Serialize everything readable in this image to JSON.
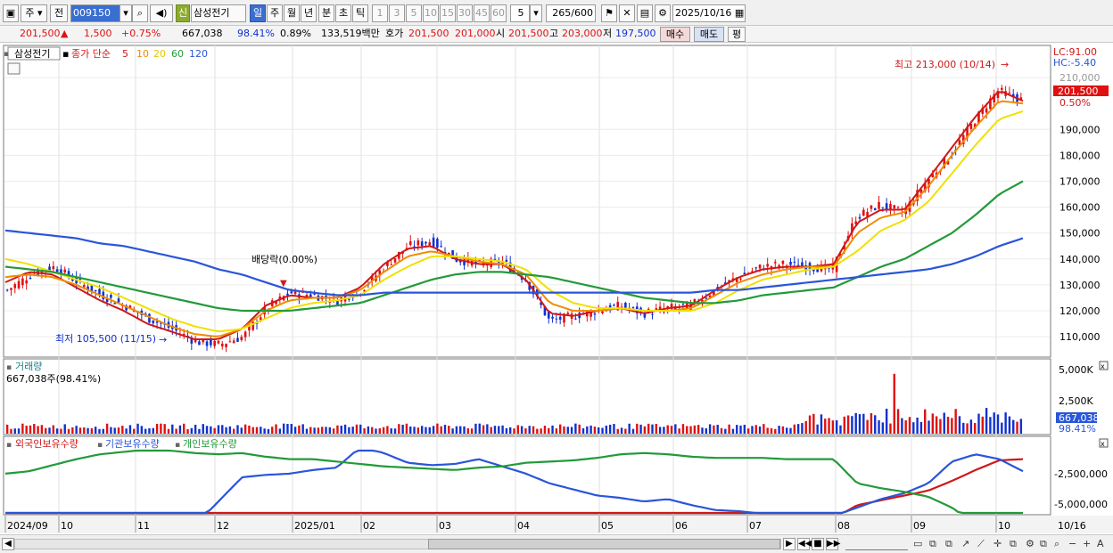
{
  "toolbar": {
    "market": "주",
    "period_type": "전",
    "code": "009150",
    "new_badge": "신",
    "stock_name": "삼성전기",
    "intervals": [
      "일",
      "주",
      "월",
      "년",
      "분",
      "초",
      "틱"
    ],
    "selected_interval": "일",
    "minute_options": [
      "1",
      "3",
      "5",
      "10",
      "15",
      "30",
      "45",
      "60"
    ],
    "count_value": "5",
    "bars_shown": "265",
    "bars_total": "/600",
    "date": "2025/10/16"
  },
  "infobar": {
    "price": "201,500",
    "change_arrow": "▲",
    "change": "1,500",
    "change_pct": "+0.75%",
    "volume": "667,038",
    "volume_ratio": "98.41%",
    "turnover": "0.89%",
    "amount": "133,519백만",
    "ask_label": "호가",
    "ask": "201,500",
    "bid": "201,000",
    "open_label": "시",
    "open": "201,500",
    "high_label": "고",
    "high": "203,000",
    "low_label": "저",
    "low": "197,500",
    "buy_label": "매수",
    "sell_label": "매도",
    "eval_label": "평"
  },
  "price_pane": {
    "name_tag": "삼성전기",
    "ma_label": "종가 단순",
    "ma_periods": [
      "5",
      "10",
      "20",
      "60",
      "120"
    ],
    "ma_colors": [
      "#d01818",
      "#f08c00",
      "#f0e000",
      "#229a3a",
      "#2a55d8"
    ],
    "high_annotation": "최고 213,000 (10/14)",
    "low_annotation": "최저 105,500 (11/15)",
    "dividend_annotation": "배당락(0.00%)",
    "lc": "LC:91.00",
    "hc": "HC:-5.40",
    "current_price_tag": "201,500",
    "current_pct_tag": "0.50%",
    "y_labels": [
      "210,000",
      "190,000",
      "180,000",
      "170,000",
      "160,000",
      "150,000",
      "140,000",
      "130,000",
      "120,000",
      "110,000"
    ]
  },
  "volume_pane": {
    "title": "거래량",
    "value_label": "667,038주(98.41%)",
    "y_labels": [
      "5,000K",
      "2,500K"
    ],
    "current_tag": "667,038",
    "current_pct": "98.41%"
  },
  "holdings_pane": {
    "legend": [
      "외국인보유수량",
      "기관보유수량",
      "개인보유수량"
    ],
    "legend_colors": [
      "#d01818",
      "#2a55d8",
      "#229a3a"
    ],
    "y_labels": [
      "-2,500,000",
      "-5,000,000"
    ]
  },
  "x_axis": {
    "labels": [
      "2024/09",
      "10",
      "11",
      "12",
      "2025/01",
      "02",
      "03",
      "04",
      "05",
      "06",
      "07",
      "08",
      "09",
      "10"
    ],
    "right_label": "10/16"
  },
  "chart_data": {
    "type": "line",
    "title": "삼성전기",
    "price_range": [
      100000,
      220000
    ],
    "daily_close_samples": [
      128000,
      134000,
      137000,
      131000,
      126000,
      122000,
      117000,
      113000,
      108000,
      107000,
      110000,
      121000,
      127000,
      126000,
      124000,
      128000,
      137000,
      145000,
      147000,
      140000,
      138000,
      139000,
      132000,
      116000,
      118000,
      120000,
      122000,
      119000,
      121000,
      122000,
      128000,
      133000,
      137000,
      138000,
      137000,
      136000,
      156000,
      161000,
      158000,
      170000,
      180000,
      193000,
      205000,
      201500
    ],
    "series": [
      {
        "name": "5",
        "values": [
          131000,
          135000,
          134000,
          129000,
          124000,
          120000,
          115000,
          112000,
          109000,
          109000,
          113000,
          122000,
          126000,
          125000,
          125000,
          129000,
          138000,
          144000,
          145000,
          140000,
          138000,
          138000,
          132000,
          119000,
          118000,
          120000,
          121000,
          119000,
          121000,
          122000,
          128000,
          133000,
          136000,
          137000,
          137000,
          138000,
          154000,
          159000,
          159000,
          171000,
          183000,
          195000,
          205000,
          201000
        ]
      },
      {
        "name": "10",
        "values": [
          133000,
          134000,
          133000,
          130000,
          126000,
          122000,
          118000,
          114000,
          111000,
          110000,
          113000,
          120000,
          124000,
          125000,
          125000,
          128000,
          135000,
          141000,
          143000,
          141000,
          139000,
          138000,
          134000,
          123000,
          120000,
          120000,
          121000,
          120000,
          120000,
          121000,
          126000,
          131000,
          134000,
          136000,
          137000,
          137000,
          150000,
          156000,
          158000,
          168000,
          180000,
          191000,
          201000,
          200000
        ]
      },
      {
        "name": "20",
        "values": [
          140000,
          138000,
          135000,
          132000,
          129000,
          125000,
          121000,
          117000,
          114000,
          112000,
          113000,
          117000,
          121000,
          123000,
          124000,
          126000,
          132000,
          137000,
          141000,
          141000,
          140000,
          139000,
          136000,
          128000,
          123000,
          121000,
          121000,
          120000,
          120000,
          120000,
          123000,
          128000,
          132000,
          134000,
          136000,
          137000,
          143000,
          151000,
          155000,
          162000,
          173000,
          184000,
          194000,
          197000
        ]
      },
      {
        "name": "60",
        "values": [
          137000,
          136000,
          135000,
          133000,
          131000,
          129000,
          127000,
          125000,
          123000,
          121000,
          120000,
          120000,
          120000,
          121000,
          122000,
          123000,
          126000,
          129000,
          132000,
          134000,
          135000,
          135000,
          134000,
          133000,
          131000,
          129000,
          127000,
          125000,
          124000,
          123000,
          123000,
          124000,
          126000,
          127000,
          128000,
          129000,
          133000,
          137000,
          140000,
          145000,
          150000,
          157000,
          165000,
          170000
        ]
      },
      {
        "name": "120",
        "values": [
          151000,
          150000,
          149000,
          148000,
          146000,
          145000,
          143000,
          141000,
          139000,
          136000,
          134000,
          131000,
          128000,
          127000,
          126000,
          126000,
          127000,
          127000,
          127000,
          127000,
          127000,
          127000,
          127000,
          127000,
          127000,
          127000,
          127000,
          127000,
          127000,
          127000,
          128000,
          128000,
          129000,
          130000,
          131000,
          132000,
          133000,
          134000,
          135000,
          136000,
          138000,
          141000,
          145000,
          148000
        ]
      }
    ],
    "holdings": [
      {
        "name": "외국인보유수량",
        "values": [
          -5.8,
          -6.2,
          -6.6,
          -7.0,
          -7.3,
          -7.1,
          -6.8,
          -6.9,
          -7.1,
          -7.3,
          -7.2,
          -7.0,
          -6.8,
          -6.6,
          -6.5,
          -6.6,
          -6.8,
          -6.9,
          -7.1,
          -7.2,
          -7.1,
          -7.2,
          -7.3,
          -7.2,
          -7.0,
          -6.9,
          -6.8,
          -6.7,
          -6.5,
          -6.3,
          -6.1,
          -6.0,
          -5.9,
          -5.9,
          -5.8,
          -5.9,
          -4.8,
          -4.4,
          -4.0,
          -3.6,
          -2.8,
          -1.9,
          -1.1,
          -1.0
        ]
      },
      {
        "name": "기관보유수량",
        "values": [
          -5.6,
          -6.0,
          -6.4,
          -6.9,
          -7.2,
          -7.4,
          -7.6,
          -7.3,
          -6.5,
          -4.5,
          -2.5,
          -2.3,
          -2.2,
          -1.9,
          -1.7,
          0.0,
          -0.5,
          -1.3,
          -1.5,
          -1.4,
          -1.0,
          -1.6,
          -2.2,
          -3.0,
          -3.5,
          -4.0,
          -4.2,
          -4.5,
          -4.3,
          -4.8,
          -5.2,
          -5.3,
          -5.5,
          -5.6,
          -5.8,
          -5.7,
          -5.0,
          -4.3,
          -3.8,
          -3.0,
          -1.2,
          -0.6,
          -1.0,
          -2.0
        ]
      },
      {
        "name": "개인보유수량",
        "values": [
          -2.2,
          -2.0,
          -1.5,
          -1.0,
          -0.6,
          -0.4,
          -0.2,
          -0.3,
          -0.5,
          -0.6,
          -0.5,
          -0.8,
          -1.0,
          -1.0,
          -1.2,
          -1.4,
          -1.6,
          -1.7,
          -1.8,
          -1.9,
          -1.7,
          -1.6,
          -1.3,
          -1.2,
          -1.1,
          -0.9,
          -0.6,
          -0.5,
          -0.6,
          -0.8,
          -0.9,
          -0.9,
          -0.9,
          -1.0,
          -1.0,
          -1.0,
          -3.0,
          -3.4,
          -3.7,
          -4.1,
          -5.0,
          -6.4,
          -7.0,
          -7.0
        ]
      }
    ],
    "holdings_unit": "millions",
    "volume_spike": {
      "date_label": "08",
      "value_k": 5300
    }
  }
}
